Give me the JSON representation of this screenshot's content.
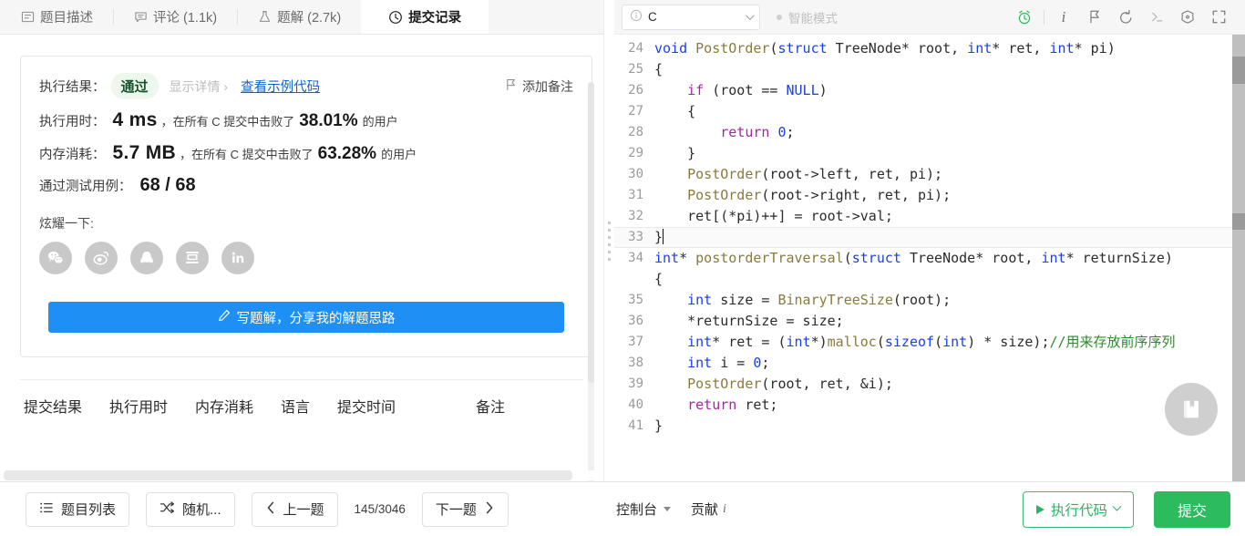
{
  "tabs": [
    {
      "label": "题目描述",
      "icon": "description-icon",
      "active": false
    },
    {
      "label": "评论 (1.1k)",
      "icon": "comment-icon",
      "active": false
    },
    {
      "label": "题解 (2.7k)",
      "icon": "flask-icon",
      "active": false
    },
    {
      "label": "提交记录",
      "icon": "clock-icon",
      "active": true
    }
  ],
  "result": {
    "result_label": "执行结果：",
    "status": "通过",
    "show_detail": "显示详情 ›",
    "view_sample": "查看示例代码",
    "add_note": "添加备注",
    "runtime_label": "执行用时：",
    "runtime_value": "4 ms",
    "runtime_mid": "，在所有 C 提交中击败了",
    "runtime_pct": "38.01%",
    "runtime_suffix": "的用户",
    "memory_label": "内存消耗：",
    "memory_value": "5.7 MB",
    "memory_mid": "，在所有 C 提交中击败了",
    "memory_pct": "63.28%",
    "memory_suffix": "的用户",
    "cases_label": "通过测试用例：",
    "cases_value": "68 / 68",
    "share_label": "炫耀一下:",
    "share_icons": [
      "wechat-icon",
      "weibo-icon",
      "qq-icon",
      "douban-icon",
      "linkedin-icon"
    ],
    "write_solution": "写题解，分享我的解题思路"
  },
  "history_table": {
    "columns": [
      "提交结果",
      "执行用时",
      "内存消耗",
      "语言",
      "提交时间",
      "备注"
    ],
    "rows": []
  },
  "editor_toolbar": {
    "language": "C",
    "info_icon": "info-circle-icon",
    "chevron_icon": "chevron-down-icon",
    "smart_mode": "智能模式",
    "tools": [
      {
        "name": "alarm-clock-icon",
        "accent": "#2cbb5d"
      },
      {
        "name": "info-italic-icon",
        "accent": "#7d7d7d"
      },
      {
        "name": "flag-icon",
        "accent": "#7d7d7d"
      },
      {
        "name": "undo-icon",
        "accent": "#7d7d7d"
      },
      {
        "name": "terminal-icon",
        "accent": "#b5b5b5"
      },
      {
        "name": "settings-gear-icon",
        "accent": "#7d7d7d"
      },
      {
        "name": "fullscreen-icon",
        "accent": "#7d7d7d"
      }
    ]
  },
  "code": {
    "language": "C",
    "lines": [
      {
        "n": "24",
        "active": false,
        "tokens": [
          {
            "t": "void",
            "c": "kw"
          },
          {
            "t": " ",
            "c": ""
          },
          {
            "t": "PostOrder",
            "c": "fn"
          },
          {
            "t": "(",
            "c": ""
          },
          {
            "t": "struct",
            "c": "kw"
          },
          {
            "t": " TreeNode* root, ",
            "c": ""
          },
          {
            "t": "int",
            "c": "kw"
          },
          {
            "t": "* ret, ",
            "c": ""
          },
          {
            "t": "int",
            "c": "kw"
          },
          {
            "t": "* pi)",
            "c": ""
          }
        ]
      },
      {
        "n": "25",
        "active": false,
        "tokens": [
          {
            "t": "{",
            "c": ""
          }
        ]
      },
      {
        "n": "26",
        "active": false,
        "tokens": [
          {
            "t": "    ",
            "c": ""
          },
          {
            "t": "if",
            "c": "ctl"
          },
          {
            "t": " (root == ",
            "c": ""
          },
          {
            "t": "NULL",
            "c": "kw"
          },
          {
            "t": ")",
            "c": ""
          }
        ]
      },
      {
        "n": "27",
        "active": false,
        "tokens": [
          {
            "t": "    {",
            "c": ""
          }
        ]
      },
      {
        "n": "28",
        "active": false,
        "tokens": [
          {
            "t": "        ",
            "c": ""
          },
          {
            "t": "return",
            "c": "ctl"
          },
          {
            "t": " ",
            "c": ""
          },
          {
            "t": "0",
            "c": "num"
          },
          {
            "t": ";",
            "c": ""
          }
        ]
      },
      {
        "n": "29",
        "active": false,
        "tokens": [
          {
            "t": "    }",
            "c": ""
          }
        ]
      },
      {
        "n": "30",
        "active": false,
        "tokens": [
          {
            "t": "    ",
            "c": ""
          },
          {
            "t": "PostOrder",
            "c": "fn"
          },
          {
            "t": "(root->left, ret, pi);",
            "c": ""
          }
        ]
      },
      {
        "n": "31",
        "active": false,
        "tokens": [
          {
            "t": "    ",
            "c": ""
          },
          {
            "t": "PostOrder",
            "c": "fn"
          },
          {
            "t": "(root->right, ret, pi);",
            "c": ""
          }
        ]
      },
      {
        "n": "32",
        "active": false,
        "tokens": [
          {
            "t": "    ret[(*pi)++] = root->val;",
            "c": ""
          }
        ]
      },
      {
        "n": "33",
        "active": true,
        "cursor": true,
        "tokens": [
          {
            "t": "}",
            "c": ""
          }
        ]
      },
      {
        "n": "34",
        "active": false,
        "tokens": [
          {
            "t": "int",
            "c": "kw"
          },
          {
            "t": "* ",
            "c": ""
          },
          {
            "t": "postorderTraversal",
            "c": "fn"
          },
          {
            "t": "(",
            "c": ""
          },
          {
            "t": "struct",
            "c": "kw"
          },
          {
            "t": " TreeNode* root, ",
            "c": ""
          },
          {
            "t": "int",
            "c": "kw"
          },
          {
            "t": "* returnSize)\n{",
            "c": ""
          }
        ]
      },
      {
        "n": "35",
        "active": false,
        "tokens": [
          {
            "t": "    ",
            "c": ""
          },
          {
            "t": "int",
            "c": "kw"
          },
          {
            "t": " size = ",
            "c": ""
          },
          {
            "t": "BinaryTreeSize",
            "c": "fn"
          },
          {
            "t": "(root);",
            "c": ""
          }
        ]
      },
      {
        "n": "36",
        "active": false,
        "tokens": [
          {
            "t": "    *returnSize = size;",
            "c": ""
          }
        ]
      },
      {
        "n": "37",
        "active": false,
        "tokens": [
          {
            "t": "    ",
            "c": ""
          },
          {
            "t": "int",
            "c": "kw"
          },
          {
            "t": "* ret = (",
            "c": ""
          },
          {
            "t": "int",
            "c": "kw"
          },
          {
            "t": "*)",
            "c": ""
          },
          {
            "t": "malloc",
            "c": "fn"
          },
          {
            "t": "(",
            "c": ""
          },
          {
            "t": "sizeof",
            "c": "kw"
          },
          {
            "t": "(",
            "c": ""
          },
          {
            "t": "int",
            "c": "kw"
          },
          {
            "t": ") * size);",
            "c": ""
          },
          {
            "t": "//用来存放前序序列",
            "c": "cmt"
          }
        ]
      },
      {
        "n": "38",
        "active": false,
        "tokens": [
          {
            "t": "    ",
            "c": ""
          },
          {
            "t": "int",
            "c": "kw"
          },
          {
            "t": " i = ",
            "c": ""
          },
          {
            "t": "0",
            "c": "num"
          },
          {
            "t": ";",
            "c": ""
          }
        ]
      },
      {
        "n": "39",
        "active": false,
        "tokens": [
          {
            "t": "    ",
            "c": ""
          },
          {
            "t": "PostOrder",
            "c": "fn"
          },
          {
            "t": "(root, ret, &i);",
            "c": ""
          }
        ]
      },
      {
        "n": "40",
        "active": false,
        "tokens": [
          {
            "t": "    ",
            "c": ""
          },
          {
            "t": "return",
            "c": "ctl"
          },
          {
            "t": " ret;",
            "c": ""
          }
        ]
      },
      {
        "n": "41",
        "active": false,
        "tokens": [
          {
            "t": "}",
            "c": ""
          }
        ]
      }
    ]
  },
  "fab": {
    "icon": "bookmark-book-icon"
  },
  "footer": {
    "problem_list": "题目列表",
    "random": "随机...",
    "prev": "上一题",
    "pager": "145/3046",
    "next": "下一题",
    "console": "控制台",
    "contribute": "贡献",
    "run_code": "执行代码",
    "submit": "提交"
  },
  "colors": {
    "green": "#2cbb5d",
    "green_outline": "#37bd6b",
    "blue": "#1e90f5",
    "link_blue": "#1565c0",
    "pass_bg": "#eef7ee",
    "pass_text": "#14532d"
  }
}
